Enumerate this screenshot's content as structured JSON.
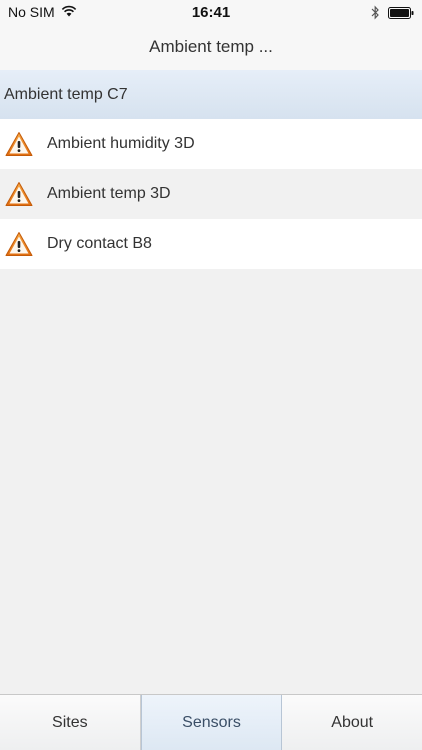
{
  "status_bar": {
    "carrier": "No SIM",
    "time": "16:41",
    "icons": [
      "wifi-icon",
      "bluetooth-icon",
      "battery-icon"
    ]
  },
  "nav": {
    "title": "Ambient temp ..."
  },
  "section": {
    "header": "Ambient temp C7"
  },
  "sensors": [
    {
      "label": "Ambient humidity 3D",
      "icon": "warning-icon"
    },
    {
      "label": "Ambient temp 3D",
      "icon": "warning-icon"
    },
    {
      "label": "Dry contact B8",
      "icon": "warning-icon"
    }
  ],
  "tabs": [
    {
      "label": "Sites",
      "active": false
    },
    {
      "label": "Sensors",
      "active": true
    },
    {
      "label": "About",
      "active": false
    }
  ],
  "colors": {
    "warning_orange": "#e8821e",
    "section_header_bg": "#dde7f2",
    "active_tab_text": "#3a4e66"
  }
}
